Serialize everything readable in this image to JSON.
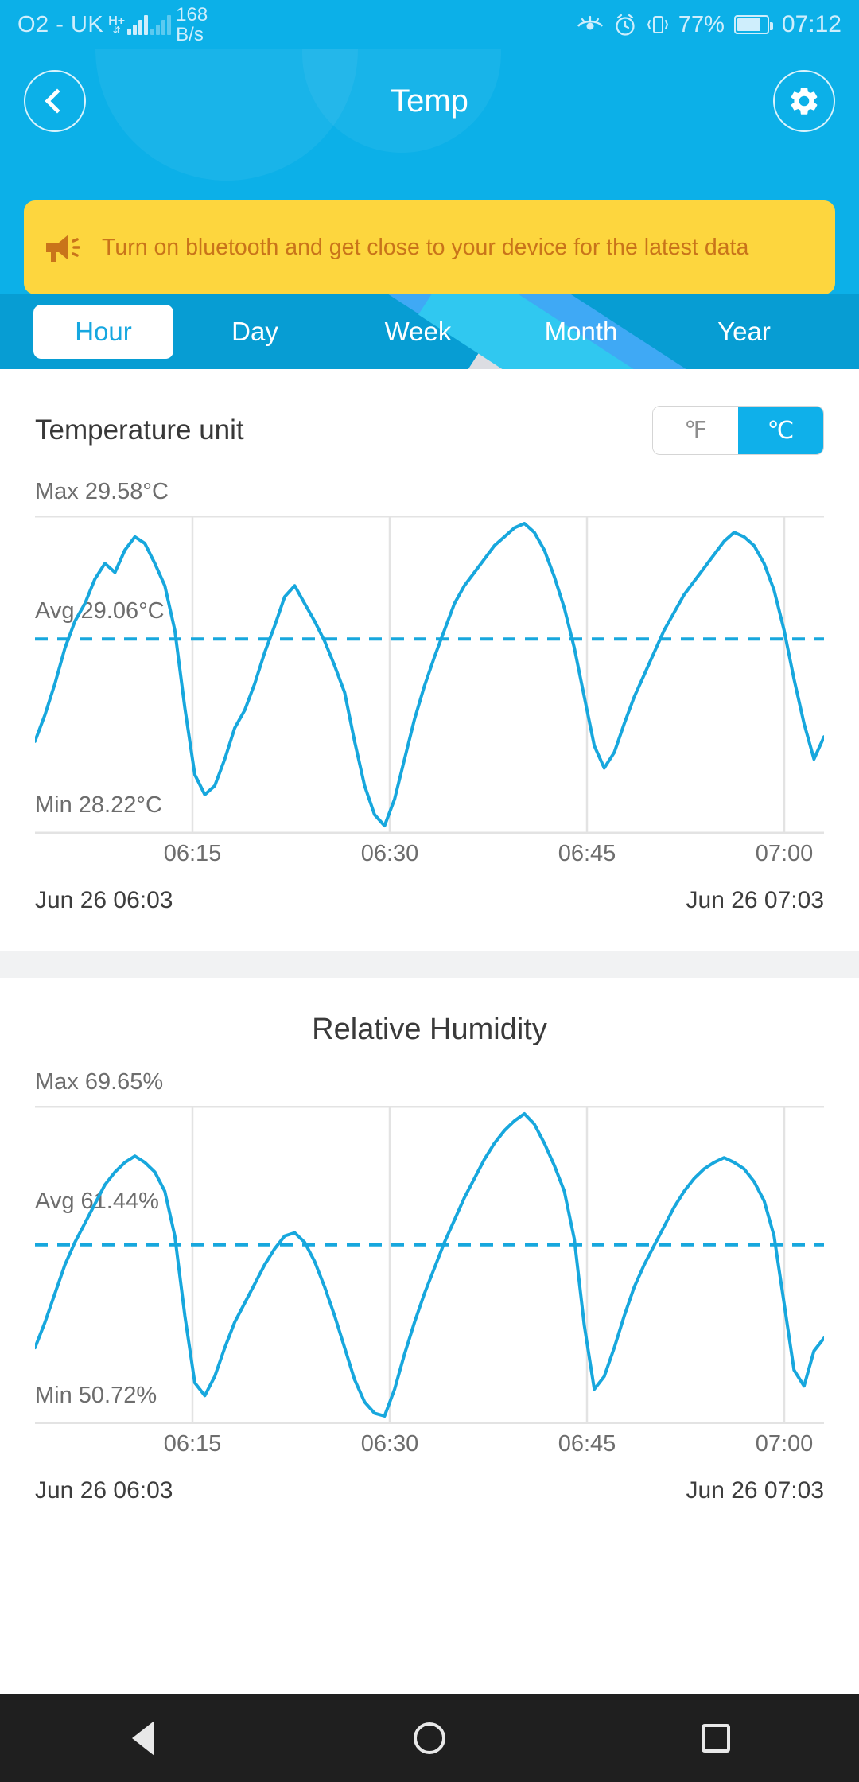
{
  "status_bar": {
    "carrier": "O2 - UK",
    "network_type": "H+",
    "net_speed_value": "168",
    "net_speed_unit": "B/s",
    "battery_percent": "77%",
    "clock": "07:12",
    "icons": [
      "eye-comfort-icon",
      "alarm-icon",
      "vibrate-icon",
      "battery-icon"
    ]
  },
  "header": {
    "title": "Temp",
    "back_icon": "back-chevron-icon",
    "settings_icon": "gear-icon"
  },
  "banner": {
    "icon": "megaphone-icon",
    "text": "Turn on bluetooth and get close to your device for the latest data",
    "bg_color": "#fdd63e",
    "text_color": "#c9741a"
  },
  "tabs": {
    "items": [
      {
        "label": "Hour",
        "active": true
      },
      {
        "label": "Day",
        "active": false
      },
      {
        "label": "Week",
        "active": false
      },
      {
        "label": "Month",
        "active": false
      },
      {
        "label": "Year",
        "active": false
      }
    ]
  },
  "temperature_card": {
    "unit_label": "Temperature unit",
    "unit_options": [
      {
        "label": "℉",
        "selected": false
      },
      {
        "label": "℃",
        "selected": true
      }
    ],
    "max_label": "Max 29.58°C",
    "avg_label": "Avg 29.06°C",
    "min_label": "Min 28.22°C",
    "x_ticks": [
      "06:15",
      "06:30",
      "06:45",
      "07:00"
    ],
    "range_start": "Jun 26 06:03",
    "range_end": "Jun 26 07:03"
  },
  "humidity_card": {
    "title": "Relative Humidity",
    "max_label": "Max 69.65%",
    "avg_label": "Avg 61.44%",
    "min_label": "Min 50.72%",
    "x_ticks": [
      "06:15",
      "06:30",
      "06:45",
      "07:00"
    ],
    "range_start": "Jun 26 06:03",
    "range_end": "Jun 26 07:03"
  },
  "nav_bar": {
    "back": "nav-back-icon",
    "home": "nav-home-icon",
    "recents": "nav-recents-icon"
  },
  "colors": {
    "brand_blue": "#0cb0e8",
    "tab_blue": "#079dd3",
    "line_blue": "#17a7dd",
    "banner_yellow": "#fdd63e"
  },
  "chart_data": [
    {
      "type": "line",
      "title": "Temp",
      "ylabel": "°C",
      "xlabel": "",
      "ylim": [
        28.22,
        29.58
      ],
      "max": 29.58,
      "avg": 29.06,
      "min": 28.22,
      "grid": true,
      "x_ticks": [
        "06:15",
        "06:30",
        "06:45",
        "07:00"
      ],
      "x_range": [
        "Jun 26 06:03",
        "Jun 26 07:03"
      ],
      "avg_line": 29.06,
      "series": [
        {
          "name": "Temperature",
          "values": [
            28.6,
            28.72,
            28.86,
            29.02,
            29.14,
            29.22,
            29.33,
            29.4,
            29.36,
            29.46,
            29.52,
            29.49,
            29.4,
            29.3,
            29.1,
            28.75,
            28.45,
            28.36,
            28.4,
            28.52,
            28.66,
            28.74,
            28.86,
            29.0,
            29.12,
            29.25,
            29.3,
            29.22,
            29.14,
            29.05,
            28.94,
            28.82,
            28.6,
            28.4,
            28.27,
            28.22,
            28.34,
            28.52,
            28.7,
            28.85,
            28.98,
            29.1,
            29.22,
            29.3,
            29.36,
            29.42,
            29.48,
            29.52,
            29.56,
            29.58,
            29.54,
            29.46,
            29.34,
            29.2,
            29.02,
            28.8,
            28.58,
            28.48,
            28.55,
            28.68,
            28.8,
            28.9,
            29.0,
            29.1,
            29.18,
            29.26,
            29.32,
            29.38,
            29.44,
            29.5,
            29.54,
            29.52,
            29.48,
            29.4,
            29.28,
            29.1,
            28.88,
            28.68,
            28.52,
            28.62
          ]
        }
      ]
    },
    {
      "type": "line",
      "title": "Relative Humidity",
      "ylabel": "%",
      "xlabel": "",
      "ylim": [
        50.72,
        69.65
      ],
      "max": 69.65,
      "avg": 61.44,
      "min": 50.72,
      "grid": true,
      "x_ticks": [
        "06:15",
        "06:30",
        "06:45",
        "07:00"
      ],
      "x_range": [
        "Jun 26 06:03",
        "Jun 26 07:03"
      ],
      "avg_line": 61.44,
      "series": [
        {
          "name": "Humidity",
          "values": [
            55.0,
            56.6,
            58.4,
            60.2,
            61.6,
            62.8,
            64.0,
            65.2,
            66.0,
            66.6,
            67.0,
            66.6,
            66.0,
            64.8,
            62.0,
            57.0,
            52.8,
            52.0,
            53.2,
            55.0,
            56.6,
            57.8,
            59.0,
            60.2,
            61.2,
            62.0,
            62.2,
            61.6,
            60.4,
            58.8,
            57.0,
            55.0,
            53.0,
            51.6,
            50.9,
            50.72,
            52.4,
            54.6,
            56.6,
            58.4,
            60.0,
            61.6,
            63.0,
            64.4,
            65.6,
            66.8,
            67.8,
            68.6,
            69.2,
            69.65,
            69.0,
            67.8,
            66.4,
            64.8,
            61.8,
            56.4,
            52.4,
            53.2,
            55.0,
            57.0,
            58.8,
            60.2,
            61.4,
            62.6,
            63.8,
            64.8,
            65.6,
            66.2,
            66.6,
            66.9,
            66.6,
            66.2,
            65.4,
            64.2,
            62.0,
            57.8,
            53.6,
            52.6,
            54.8,
            55.6
          ]
        }
      ]
    }
  ]
}
